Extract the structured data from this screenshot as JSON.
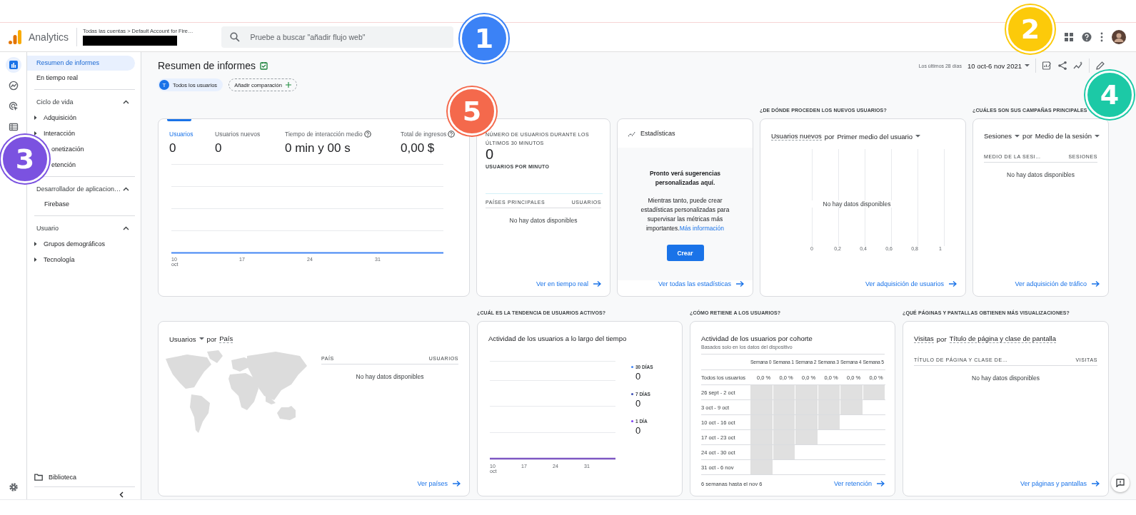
{
  "header": {
    "product": "Analytics",
    "breadcrumb": "Todas las cuentas > Default Account for Fire…",
    "search": {
      "placeholder": "Pruebe a buscar \"añadir flujo web\""
    }
  },
  "rail": [
    {
      "selected": true
    },
    {
      "selected": false
    },
    {
      "selected": false
    },
    {
      "selected": false
    }
  ],
  "nav": {
    "items": [
      {
        "kind": "link",
        "label": "Resumen de informes",
        "selected": true
      },
      {
        "kind": "link",
        "label": "En tiempo real",
        "selected": false
      },
      {
        "kind": "section",
        "label": "Ciclo de vida",
        "expanded": true,
        "children": [
          {
            "kind": "group",
            "label": "Adquisición",
            "expanded": false
          },
          {
            "kind": "group",
            "label": "Interacción",
            "expanded": false
          },
          {
            "kind": "covered",
            "label": "onetización"
          },
          {
            "kind": "covered",
            "label": "etención"
          }
        ]
      },
      {
        "kind": "section",
        "label": "Desarrollador de aplicacion…",
        "expanded": true,
        "children": [
          {
            "kind": "link",
            "label": "Firebase",
            "selected": false
          }
        ]
      },
      {
        "kind": "section",
        "label": "Usuario",
        "expanded": true,
        "children": [
          {
            "kind": "group",
            "label": "Grupos demográficos",
            "expanded": false
          },
          {
            "kind": "group",
            "label": "Tecnología",
            "expanded": false
          }
        ]
      }
    ],
    "library": "Biblioteca"
  },
  "report": {
    "title": "Resumen de informes",
    "segment": {
      "initial": "T",
      "label": "Todos los usuarios"
    },
    "add_comparison": "Añadir comparación",
    "date_preset": "Los últimos 28 días",
    "date_range": "10 oct-6 nov 2021"
  },
  "cards_row_1": [
    {
      "kind": "metrics",
      "metrics": [
        {
          "label": "Usuarios",
          "value": "0",
          "selected": true,
          "help": false
        },
        {
          "label": "Usuarios nuevos",
          "value": "0",
          "selected": false,
          "help": false
        },
        {
          "label": "Tiempo de interacción medio",
          "value": "0 min y 00 s",
          "selected": false,
          "help": true
        },
        {
          "label": "Total de ingresos",
          "value": "0,00 $",
          "selected": false,
          "help": true
        }
      ],
      "x_ticks": [
        "10 oct",
        "17",
        "24",
        "31"
      ]
    },
    {
      "kind": "realtime",
      "heading": "NÚMERO DE USUARIOS DURANTE LOS ÚLTIMOS 30 MINUTOS",
      "value": "0",
      "sub": "USUARIOS POR MINUTO",
      "columns": [
        "PAÍSES PRINCIPALES",
        "USUARIOS"
      ],
      "empty": "No hay datos disponibles",
      "link": "Ver en tiempo real"
    },
    {
      "kind": "insights",
      "title": "Estadísticas",
      "lead": "Pronto verá sugerencias personalizadas aquí.",
      "body": "Mientras tanto, puede crear estadísticas personalizadas para supervisar las métricas más importantes.",
      "more": "Más información",
      "button": "Crear",
      "link": "Ver todas las estadísticas"
    },
    {
      "kind": "bars",
      "question": "¿DE DÓNDE PROCEDEN LOS NUEVOS USUARIOS?",
      "title": [
        {
          "text": "Usuarios nuevos",
          "kind": "underlined"
        },
        {
          "text": "por",
          "kind": "plain"
        },
        {
          "text": "Primer medio del usuario",
          "kind": "dropdown"
        }
      ],
      "x_ticks": [
        "0",
        "0,2",
        "0,4",
        "0,6",
        "0,8",
        "1"
      ],
      "empty": "No hay datos disponibles",
      "link": "Ver adquisición de usuarios"
    },
    {
      "kind": "table",
      "question": "¿CUÁLES SON SUS CAMPAÑAS PRINCIPALES",
      "title": [
        {
          "text": "Sesiones",
          "kind": "dropdown"
        },
        {
          "text": "por",
          "kind": "plain"
        },
        {
          "text": "Medio de la sesión",
          "kind": "dropdown"
        }
      ],
      "columns": [
        "MEDIO DE LA SESI…",
        "SESIONES"
      ],
      "empty": "No hay datos disponibles",
      "link": "Ver adquisición de tráfico"
    }
  ],
  "cards_row_2": [
    {
      "kind": "map",
      "title": [
        {
          "text": "Usuarios",
          "kind": "dropdown"
        },
        {
          "text": "por",
          "kind": "plain"
        },
        {
          "text": "País",
          "kind": "underlined"
        }
      ],
      "columns": [
        "PAÍS",
        "USUARIOS"
      ],
      "empty": "No hay datos disponibles",
      "link": "Ver países"
    },
    {
      "kind": "trend",
      "question": "¿CUÁL ES LA TENDENCIA DE USUARIOS ACTIVOS?",
      "title": "Actividad de los usuarios a lo largo del tiempo",
      "x_ticks": [
        "10 oct",
        "17",
        "24",
        "31"
      ],
      "legend": [
        {
          "label": "30 DÍAS",
          "value": "0",
          "color": "#4285f4"
        },
        {
          "label": "7 DÍAS",
          "value": "0",
          "color": "#3f51b5"
        },
        {
          "label": "1 DÍA",
          "value": "0",
          "color": "#7e3ff2"
        }
      ]
    },
    {
      "kind": "cohort",
      "question": "¿CÓMO RETIENE A LOS USUARIOS?",
      "title": "Actividad de los usuarios por cohorte",
      "subtitle": "Basados solo en los datos del dispositivo",
      "weeks": [
        "Semana 0",
        "Semana 1",
        "Semana 2",
        "Semana 3",
        "Semana 4",
        "Semana 5"
      ],
      "total": {
        "label": "Todos los usuarios",
        "values": [
          "0,0 %",
          "0,0 %",
          "0,0 %",
          "0,0 %",
          "0,0 %",
          "0,0 %"
        ]
      },
      "rows": [
        {
          "label": "26 sept - 2 oct",
          "cells": [
            {
              "filled": true
            },
            {
              "filled": true
            },
            {
              "filled": true
            },
            {
              "filled": true
            },
            {
              "filled": true
            },
            {
              "filled": true
            }
          ]
        },
        {
          "label": "3 oct - 9 oct",
          "cells": [
            {
              "filled": true
            },
            {
              "filled": true
            },
            {
              "filled": true
            },
            {
              "filled": true
            },
            {
              "filled": true
            },
            {
              "filled": false
            }
          ]
        },
        {
          "label": "10 oct - 16 oct",
          "cells": [
            {
              "filled": true
            },
            {
              "filled": true
            },
            {
              "filled": true
            },
            {
              "filled": true
            },
            {
              "filled": false
            },
            {
              "filled": false
            }
          ]
        },
        {
          "label": "17 oct - 23 oct",
          "cells": [
            {
              "filled": true
            },
            {
              "filled": true
            },
            {
              "filled": true
            },
            {
              "filled": false
            },
            {
              "filled": false
            },
            {
              "filled": false
            }
          ]
        },
        {
          "label": "24 oct - 30 oct",
          "cells": [
            {
              "filled": true
            },
            {
              "filled": true
            },
            {
              "filled": false
            },
            {
              "filled": false
            },
            {
              "filled": false
            },
            {
              "filled": false
            }
          ]
        },
        {
          "label": "31 oct - 6 nov",
          "cells": [
            {
              "filled": true
            },
            {
              "filled": false
            },
            {
              "filled": false
            },
            {
              "filled": false
            },
            {
              "filled": false
            },
            {
              "filled": false
            }
          ]
        }
      ],
      "footnote": "6 semanas hasta el nov 6",
      "link": "Ver retención"
    },
    {
      "kind": "table",
      "question": "¿QUÉ PÁGINAS Y PANTALLAS OBTIENEN MÁS VISUALIZACIONES?",
      "title": [
        {
          "text": "Visitas",
          "kind": "underlined"
        },
        {
          "text": "por",
          "kind": "plain"
        },
        {
          "text": "Título de página y clase de pantalla",
          "kind": "underlined"
        }
      ],
      "columns": [
        "TÍTULO DE PÁGINA Y CLASE DE…",
        "VISITAS"
      ],
      "empty": "No hay datos disponibles",
      "link": "Ver páginas y pantallas"
    }
  ],
  "annotations": [
    {
      "label": "1",
      "color": "#3b82f6"
    },
    {
      "label": "2",
      "color": "#fcca0a"
    },
    {
      "label": "3",
      "color": "#7b52e0"
    },
    {
      "label": "4",
      "color": "#1cc9a6"
    },
    {
      "label": "5",
      "color": "#f4694c"
    }
  ]
}
